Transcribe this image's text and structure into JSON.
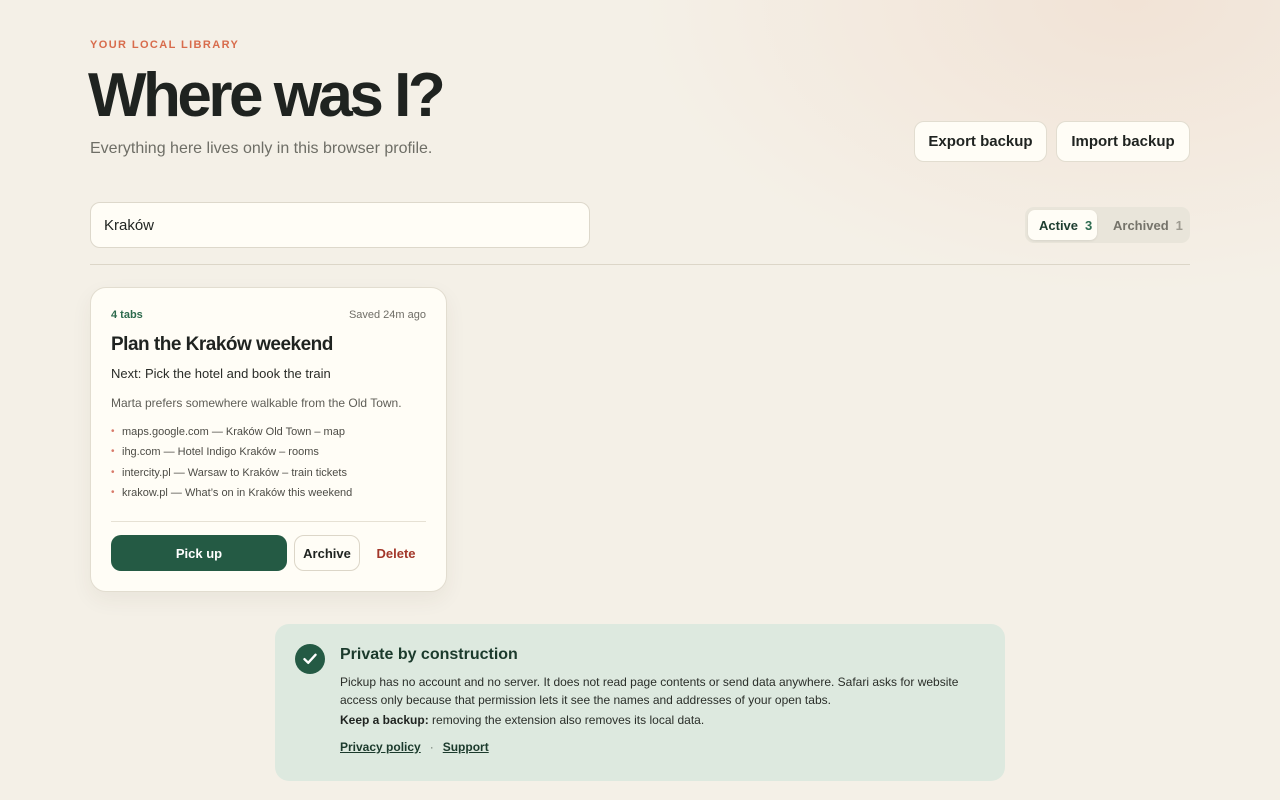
{
  "header": {
    "eyebrow": "YOUR LOCAL LIBRARY",
    "title": "Where was I?",
    "subtitle": "Everything here lives only in this browser profile.",
    "export_label": "Export backup",
    "import_label": "Import backup"
  },
  "search": {
    "value": "Kraków",
    "placeholder": "Search"
  },
  "filter": {
    "active_label": "Active",
    "active_count": "3",
    "archived_label": "Archived",
    "archived_count": "1"
  },
  "sessions": [
    {
      "tabs_count": "4 tabs",
      "saved": "Saved 24m ago",
      "title": "Plan the Kraków weekend",
      "next": "Next: Pick the hotel and book the train",
      "note": "Marta prefers somewhere walkable from the Old Town.",
      "tabs": [
        "maps.google.com — Kraków Old Town – map",
        "ihg.com — Hotel Indigo Kraków – rooms",
        "intercity.pl — Warsaw to Kraków – train tickets",
        "krakow.pl — What’s on in Kraków this weekend"
      ],
      "pickup_label": "Pick up",
      "archive_label": "Archive",
      "delete_label": "Delete"
    }
  ],
  "privacy": {
    "title": "Private by construction",
    "body": "Pickup has no account and no server. It does not read page contents or send data anywhere. Safari asks for website access only because that permission lets it see the names and addresses of your open tabs.",
    "backup_strong": "Keep a backup:",
    "backup_text": " removing the extension also removes its local data.",
    "privacy_link": "Privacy policy",
    "separator": "·",
    "support_link": "Support"
  },
  "icons": {
    "check": "check-icon",
    "bullet": "•"
  },
  "colors": {
    "accent_green": "#245a44",
    "eyebrow_coral": "#d86c4c",
    "delete_red": "#a3372a",
    "background": "#f4f0e7",
    "privacy_bg": "#dde9df"
  }
}
